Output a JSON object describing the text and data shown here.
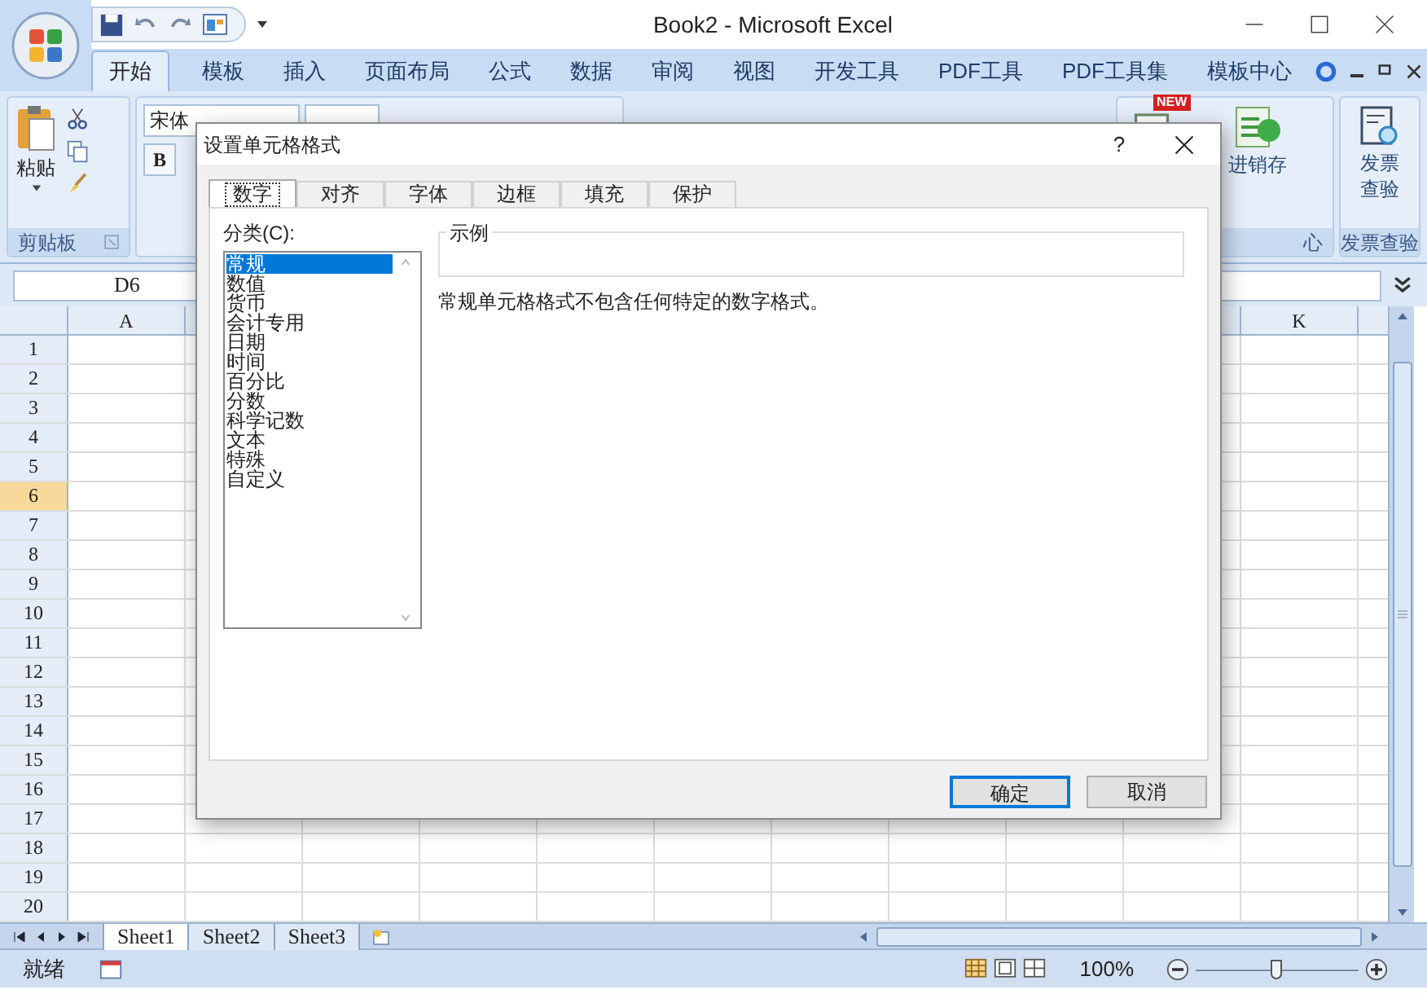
{
  "window": {
    "title": "Book2 - Microsoft Excel"
  },
  "ribbon_tabs": [
    {
      "label": "开始",
      "selected": true
    },
    {
      "label": "模板",
      "selected": false
    },
    {
      "label": "插入",
      "selected": false
    },
    {
      "label": "页面布局",
      "selected": false
    },
    {
      "label": "公式",
      "selected": false
    },
    {
      "label": "数据",
      "selected": false
    },
    {
      "label": "审阅",
      "selected": false
    },
    {
      "label": "视图",
      "selected": false
    },
    {
      "label": "开发工具",
      "selected": false
    },
    {
      "label": "PDF工具",
      "selected": false
    },
    {
      "label": "PDF工具集",
      "selected": false
    },
    {
      "label": "模板中心",
      "selected": false
    }
  ],
  "ribbon": {
    "paste_label": "粘贴",
    "clipboard_group": "剪贴板",
    "font_name": "宋体",
    "bold_label": "B",
    "new_badge": "NEW",
    "template_group_fragment": "心",
    "inventory_label": "进销存",
    "invoice_button": "发票查验",
    "invoice_group": "发票查验"
  },
  "name_box": "D6",
  "column_headers": {
    "first": "A",
    "last": "K"
  },
  "rows": [
    {
      "label": "1",
      "selected": false
    },
    {
      "label": "2",
      "selected": false
    },
    {
      "label": "3",
      "selected": false
    },
    {
      "label": "4",
      "selected": false
    },
    {
      "label": "5",
      "selected": false
    },
    {
      "label": "6",
      "selected": true
    },
    {
      "label": "7",
      "selected": false
    },
    {
      "label": "8",
      "selected": false
    },
    {
      "label": "9",
      "selected": false
    },
    {
      "label": "10",
      "selected": false
    },
    {
      "label": "11",
      "selected": false
    },
    {
      "label": "12",
      "selected": false
    },
    {
      "label": "13",
      "selected": false
    },
    {
      "label": "14",
      "selected": false
    },
    {
      "label": "15",
      "selected": false
    },
    {
      "label": "16",
      "selected": false
    },
    {
      "label": "17",
      "selected": false
    },
    {
      "label": "18",
      "selected": false
    },
    {
      "label": "19",
      "selected": false
    },
    {
      "label": "20",
      "selected": false
    }
  ],
  "sheet_tabs": [
    {
      "label": "Sheet1",
      "selected": true
    },
    {
      "label": "Sheet2",
      "selected": false
    },
    {
      "label": "Sheet3",
      "selected": false
    }
  ],
  "status_bar": {
    "state": "就绪",
    "zoom": "100%",
    "zoom_slider": {
      "level": 0.5
    }
  },
  "dialog": {
    "title": "设置单元格格式",
    "help": "?",
    "tabs": [
      {
        "label": "数字",
        "selected": true
      },
      {
        "label": "对齐",
        "selected": false
      },
      {
        "label": "字体",
        "selected": false
      },
      {
        "label": "边框",
        "selected": false
      },
      {
        "label": "填充",
        "selected": false
      },
      {
        "label": "保护",
        "selected": false
      }
    ],
    "category_label": "分类(C):",
    "categories": [
      {
        "label": "常规",
        "selected": true
      },
      {
        "label": "数值",
        "selected": false
      },
      {
        "label": "货币",
        "selected": false
      },
      {
        "label": "会计专用",
        "selected": false
      },
      {
        "label": "日期",
        "selected": false
      },
      {
        "label": "时间",
        "selected": false
      },
      {
        "label": "百分比",
        "selected": false
      },
      {
        "label": "分数",
        "selected": false
      },
      {
        "label": "科学记数",
        "selected": false
      },
      {
        "label": "文本",
        "selected": false
      },
      {
        "label": "特殊",
        "selected": false
      },
      {
        "label": "自定义",
        "selected": false
      }
    ],
    "sample_label": "示例",
    "description": "常规单元格格式不包含任何特定的数字格式。",
    "buttons": [
      {
        "label": "确定",
        "default": true
      },
      {
        "label": "取消",
        "default": false
      }
    ]
  }
}
